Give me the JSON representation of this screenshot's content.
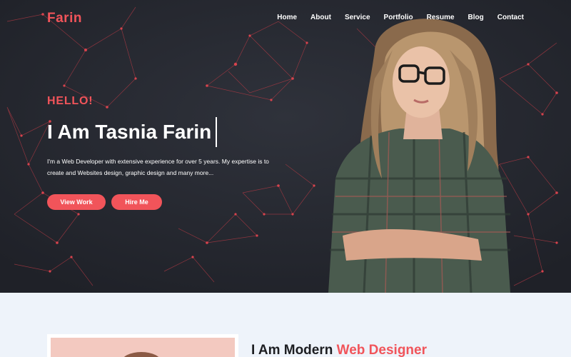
{
  "brand": {
    "logo": "Farin",
    "accent": "#f1545a",
    "hero_bg": "#24262f"
  },
  "nav": {
    "items": [
      {
        "label": "Home"
      },
      {
        "label": "About"
      },
      {
        "label": "Service"
      },
      {
        "label": "Portfolio"
      },
      {
        "label": "Resume"
      },
      {
        "label": "Blog"
      },
      {
        "label": "Contact"
      }
    ]
  },
  "hero": {
    "greeting": "HELLO!",
    "headline": "I Am Tasnia Farin",
    "intro": "I'm a Web Developer with extensive experience for over 5 years. My expertise is to create and Websites design, graphic design and many more...",
    "buttons": {
      "view_work": "View Work",
      "hire_me": "Hire Me"
    }
  },
  "about": {
    "heading_prefix": "I Am Modern ",
    "heading_accent": "Web Designer"
  }
}
